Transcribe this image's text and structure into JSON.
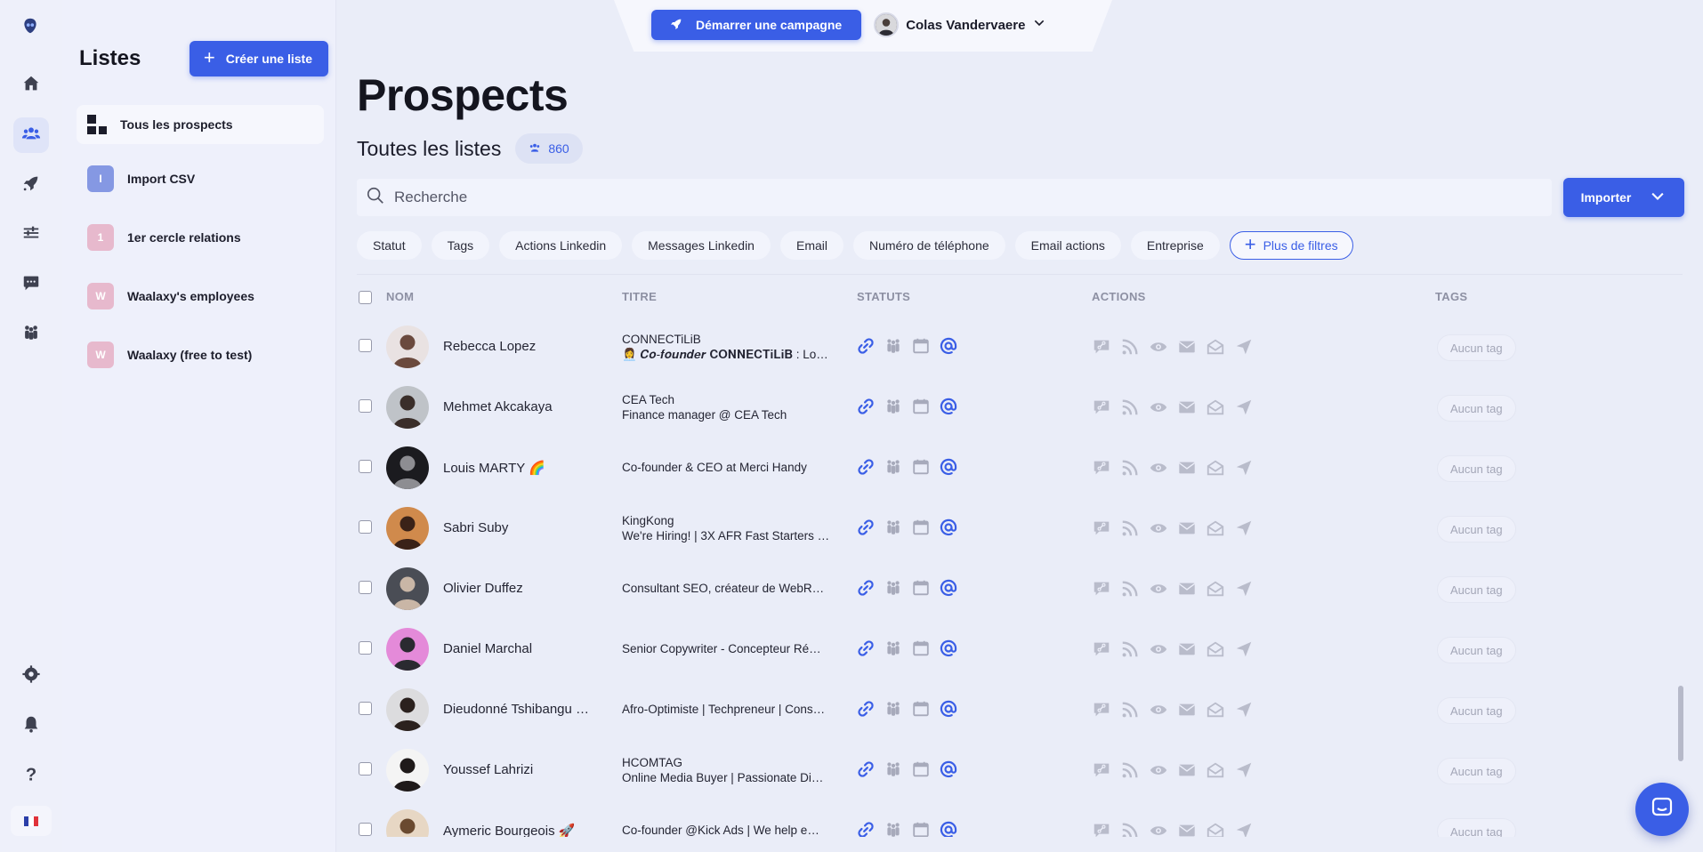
{
  "nav": {
    "items": [
      {
        "icon": "home-icon"
      },
      {
        "icon": "users-icon",
        "active": true
      },
      {
        "icon": "rocket-icon"
      },
      {
        "icon": "filters-icon"
      },
      {
        "icon": "chat-icon"
      },
      {
        "icon": "team-icon"
      }
    ],
    "bottom": [
      {
        "icon": "gear-icon"
      },
      {
        "icon": "bell-icon"
      },
      {
        "icon": "help-icon"
      }
    ],
    "language_flag": "fr-flag-icon"
  },
  "lists_panel": {
    "title": "Listes",
    "create_label": "Créer une liste",
    "items": [
      {
        "label": "Tous les prospects",
        "badge": "",
        "color": "",
        "active": true
      },
      {
        "label": "Import CSV",
        "badge": "I",
        "color": "#8598e3"
      },
      {
        "label": "1er cercle relations",
        "badge": "1",
        "color": "#e7b9cd"
      },
      {
        "label": "Waalaxy's employees",
        "badge": "W",
        "color": "#e7b9cd"
      },
      {
        "label": "Waalaxy (free to test)",
        "badge": "W",
        "color": "#e7b9cd"
      }
    ]
  },
  "topbar": {
    "campaign_label": "Démarrer une campagne",
    "user_name": "Colas Vandervaere"
  },
  "main": {
    "title": "Prospects",
    "subtitle": "Toutes les listes",
    "count": "860",
    "search_placeholder": "Recherche",
    "import_label": "Importer",
    "filters": [
      "Statut",
      "Tags",
      "Actions Linkedin",
      "Messages Linkedin",
      "Email",
      "Numéro de téléphone",
      "Email actions",
      "Entreprise"
    ],
    "more_filters_label": "Plus de filtres",
    "columns": {
      "name": "NOM",
      "title": "TITRE",
      "statuts": "STATUTS",
      "actions": "ACTIONS",
      "tags": "TAGS"
    }
  },
  "rows": [
    {
      "name": "Rebecca Lopez",
      "title1": "CONNECTiLiB",
      "title2": "👩‍💼 𝑪𝒐-𝒇𝒐𝒖𝒏𝒅𝒆𝒓 𝐂𝐎𝐍𝐍𝐄𝐂𝐓𝐢𝐋𝐢𝐁 : Lo…",
      "tag": "Aucun tag",
      "avatar_bg": "#e9e2e2",
      "avatar_fg": "#6b4a3e"
    },
    {
      "name": "Mehmet Akcakaya",
      "title1": "CEA Tech",
      "title2": "Finance manager @ CEA Tech",
      "tag": "Aucun tag",
      "avatar_bg": "#bfc3c8",
      "avatar_fg": "#3a2e2a"
    },
    {
      "name": "Louis MARTY 🌈",
      "title1": "Co-founder & CEO at Merci Handy",
      "title2": "",
      "tag": "Aucun tag",
      "avatar_bg": "#1b1b1f",
      "avatar_fg": "#8d8d92"
    },
    {
      "name": "Sabri Suby",
      "title1": "KingKong",
      "title2": "We're Hiring! | 3X AFR Fast Starters …",
      "tag": "Aucun tag",
      "avatar_bg": "#d08a4c",
      "avatar_fg": "#3a2218"
    },
    {
      "name": "Olivier Duffez",
      "title1": "Consultant SEO, créateur de WebR…",
      "title2": "",
      "tag": "Aucun tag",
      "avatar_bg": "#4a4d55",
      "avatar_fg": "#c9b6a6"
    },
    {
      "name": "Daniel Marchal",
      "title1": "Senior Copywriter - Concepteur Ré…",
      "title2": "",
      "tag": "Aucun tag",
      "avatar_bg": "#e48ad9",
      "avatar_fg": "#2a2a30"
    },
    {
      "name": "Dieudonné Tshibangu …",
      "title1": "Afro-Optimiste | Techpreneur | Cons…",
      "title2": "",
      "tag": "Aucun tag",
      "avatar_bg": "#dcdcde",
      "avatar_fg": "#2b211e"
    },
    {
      "name": "Youssef Lahrizi",
      "title1": "HCOMTAG",
      "title2": "Online Media Buyer | Passionate Di…",
      "tag": "Aucun tag",
      "avatar_bg": "#f4f4f4",
      "avatar_fg": "#1f1a1a"
    },
    {
      "name": "Aymeric Bourgeois 🚀",
      "title1": "Co-founder @Kick Ads | We help e…",
      "title2": "",
      "tag": "Aucun tag",
      "avatar_bg": "#e7d7c4",
      "avatar_fg": "#6a4a30"
    }
  ],
  "colors": {
    "accent": "#3a5ee6",
    "status_icon": "#3a5ee6",
    "status_inactive": "#a7aabb",
    "action_icon": "#b9bccb"
  }
}
